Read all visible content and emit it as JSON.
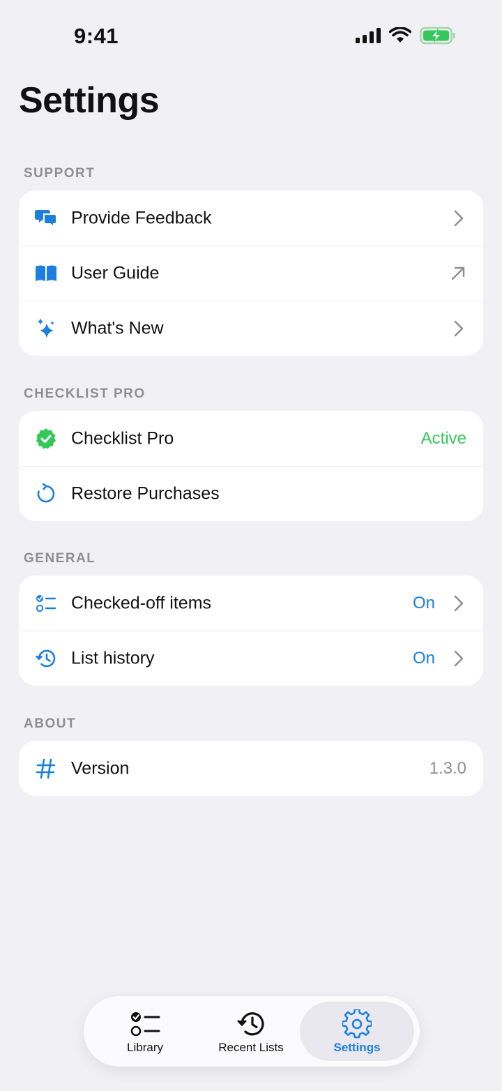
{
  "status_bar": {
    "time": "9:41"
  },
  "page": {
    "title": "Settings"
  },
  "sections": {
    "support": {
      "header": "SUPPORT",
      "items": [
        {
          "label": "Provide Feedback",
          "icon": "chat-bubbles-icon"
        },
        {
          "label": "User Guide",
          "icon": "book-icon"
        },
        {
          "label": "What's New",
          "icon": "sparkles-icon"
        }
      ]
    },
    "pro": {
      "header": "CHECKLIST PRO",
      "items": [
        {
          "label": "Checklist Pro",
          "value": "Active",
          "icon": "checkmark-seal-icon"
        },
        {
          "label": "Restore Purchases",
          "icon": "refresh-icon"
        }
      ]
    },
    "general": {
      "header": "GENERAL",
      "items": [
        {
          "label": "Checked-off items",
          "value": "On",
          "icon": "checklist-icon"
        },
        {
          "label": "List history",
          "value": "On",
          "icon": "history-icon"
        }
      ]
    },
    "about": {
      "header": "ABOUT",
      "items": [
        {
          "label": "Version",
          "value": "1.3.0",
          "icon": "hash-icon"
        }
      ]
    }
  },
  "tab_bar": {
    "tabs": [
      {
        "label": "Library",
        "icon": "checklist-icon"
      },
      {
        "label": "Recent Lists",
        "icon": "history-icon"
      },
      {
        "label": "Settings",
        "icon": "gear-icon",
        "active": true
      }
    ]
  },
  "colors": {
    "accent": "#1c7fe0",
    "success": "#34c759",
    "background": "#f0f0f5",
    "secondary_text": "#8e8e93"
  }
}
